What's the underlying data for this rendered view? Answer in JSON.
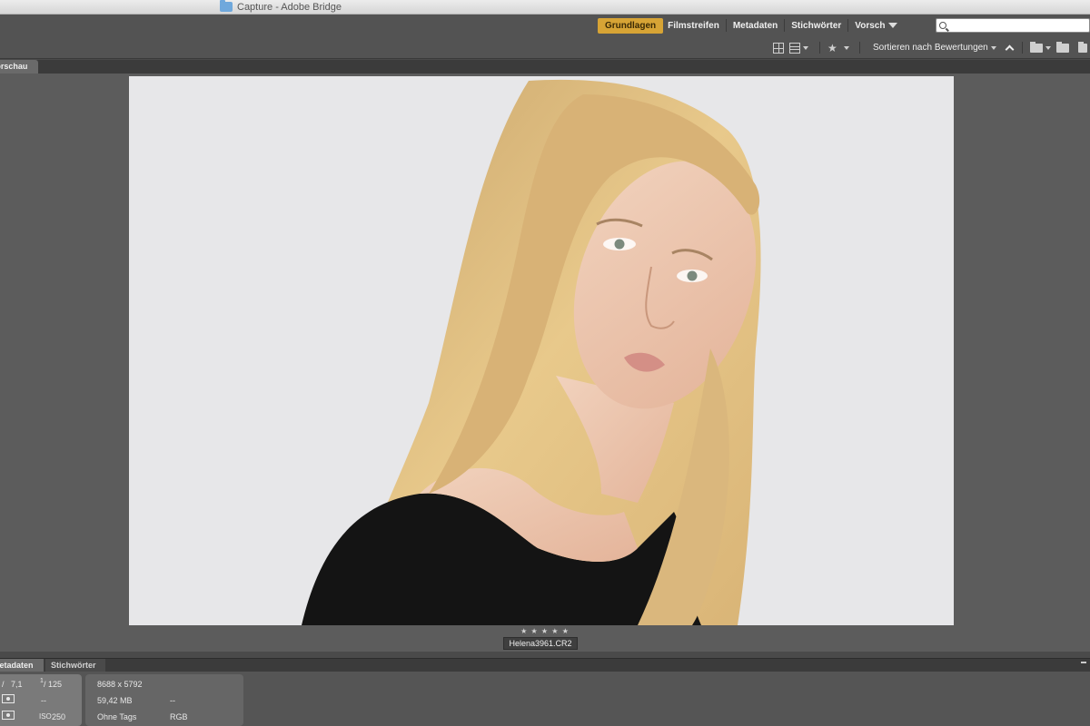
{
  "window": {
    "title": "Capture - Adobe Bridge"
  },
  "workspaces": [
    {
      "label": "Grundlagen",
      "active": true
    },
    {
      "label": "Filmstreifen",
      "active": false
    },
    {
      "label": "Metadaten",
      "active": false
    },
    {
      "label": "Stichwörter",
      "active": false
    },
    {
      "label": "Vorschau",
      "active": false
    }
  ],
  "search": {
    "placeholder": "",
    "value": ""
  },
  "toolbar": {
    "sort_label": "Sortieren nach Bewertungen"
  },
  "panels": {
    "preview_tab": "Vorschau",
    "metadata_tab": "Metadaten",
    "keywords_tab": "Stichwörter"
  },
  "preview": {
    "rating_stars": "★ ★ ★ ★ ★",
    "filename": "Helena3961.CR2"
  },
  "metadata": {
    "aperture": "7,1",
    "shutter_num": "1",
    "shutter_den": "125",
    "metering_value": "--",
    "iso_label": "ISO",
    "iso_value": "250",
    "dimensions": "8688 x 5792",
    "file_size": "59,42 MB",
    "size_extra": "--",
    "tags": "Ohne Tags",
    "color_mode": "RGB"
  },
  "colors": {
    "accent": "#d7a435",
    "chrome": "#535353",
    "preview_bg": "#5c5c5c",
    "photo_bg": "#e7e7e9"
  }
}
